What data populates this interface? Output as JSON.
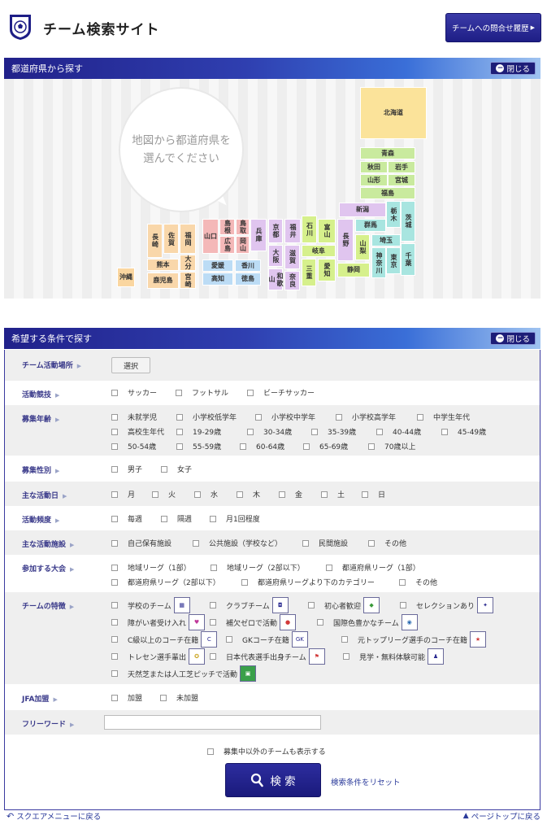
{
  "header": {
    "site_title": "チーム検索サイト",
    "history_button": "チームへの問合せ履歴"
  },
  "map_panel": {
    "title": "都道府県から探す",
    "close_label": "閉じる",
    "bubble_line1": "地図から都道府県を",
    "bubble_line2": "選んでください",
    "prefectures": {
      "hokkaido": "北海道",
      "aomori": "青森",
      "akita": "秋田",
      "iwate": "岩手",
      "yamagata": "山形",
      "miyagi": "宮城",
      "fukushima": "福島",
      "niigata": "新潟",
      "tochigi": "栃木",
      "ibaraki": "茨城",
      "gunma": "群馬",
      "saitama": "埼玉",
      "chiba": "千葉",
      "tokyo": "東京",
      "kanagawa": "神奈川",
      "yamanashi": "山梨",
      "nagano": "長野",
      "toyama": "富山",
      "ishikawa": "石川",
      "fukui": "福井",
      "gifu": "岐阜",
      "aichi": "愛知",
      "shizuoka": "静岡",
      "mie": "三重",
      "shiga": "滋賀",
      "kyoto": "京都",
      "osaka": "大阪",
      "hyogo": "兵庫",
      "nara": "奈良",
      "wakayama": "和歌山",
      "tottori": "鳥取",
      "shimane": "島根",
      "okayama": "岡山",
      "hiroshima": "広島",
      "yamaguchi": "山口",
      "kagawa": "香川",
      "tokushima": "徳島",
      "ehime": "愛媛",
      "kochi": "高知",
      "fukuoka": "福岡",
      "saga": "佐賀",
      "nagasaki": "長崎",
      "oita": "大分",
      "kumamoto": "熊本",
      "miyazaki": "宮崎",
      "kagoshima": "鹿児島",
      "okinawa": "沖縄"
    }
  },
  "cond_panel": {
    "title": "希望する条件で探す",
    "close_label": "閉じる",
    "location_label": "チーム活動場所",
    "select_button": "選択",
    "sport_label": "活動競技",
    "sports": [
      "サッカー",
      "フットサル",
      "ビーチサッカー"
    ],
    "age_label": "募集年齢",
    "ages": [
      "未就学児",
      "小学校低学年",
      "小学校中学年",
      "小学校高学年",
      "中学生年代",
      "高校生年代",
      "19-29歳",
      "30-34歳",
      "35-39歳",
      "40-44歳",
      "45-49歳",
      "50-54歳",
      "55-59歳",
      "60-64歳",
      "65-69歳",
      "70歳以上"
    ],
    "gender_label": "募集性別",
    "genders": [
      "男子",
      "女子"
    ],
    "day_label": "主な活動日",
    "days": [
      "月",
      "火",
      "水",
      "木",
      "金",
      "土",
      "日"
    ],
    "freq_label": "活動頻度",
    "freqs": [
      "毎週",
      "隔週",
      "月1回程度"
    ],
    "facility_label": "主な活動施設",
    "facilities": [
      "自己保有施設",
      "公共施設（学校など）",
      "民間施設",
      "その他"
    ],
    "league_label": "参加する大会",
    "leagues": [
      "地域リーグ（1部）",
      "地域リーグ（2部以下）",
      "都道府県リーグ（1部）",
      "都道府県リーグ（2部以下）",
      "都道府県リーグより下のカテゴリー",
      "その他"
    ],
    "feature_label": "チームの特徴",
    "features": [
      "学校のチーム",
      "クラブチーム",
      "初心者歓迎",
      "セレクションあり",
      "障がい者受け入れ",
      "補欠ゼロで活動",
      "国際色豊かなチーム",
      "C級以上のコーチ在籍",
      "GKコーチ在籍",
      "元トップリーグ選手のコーチ在籍",
      "トレセン選手輩出",
      "日本代表選手出身チーム",
      "見学・無料体験可能",
      "天然芝または人工芝ピッチで活動"
    ],
    "jfa_label": "JFA加盟",
    "jfa": [
      "加盟",
      "未加盟"
    ],
    "freeword_label": "フリーワード",
    "freeword_value": "",
    "show_all_label": "募集中以外のチームも表示する",
    "search_button": "検 索",
    "reset_link": "検索条件をリセット"
  },
  "footer": {
    "back_link": "スクエアメニューに戻る",
    "top_link": "ページトップに戻る"
  }
}
